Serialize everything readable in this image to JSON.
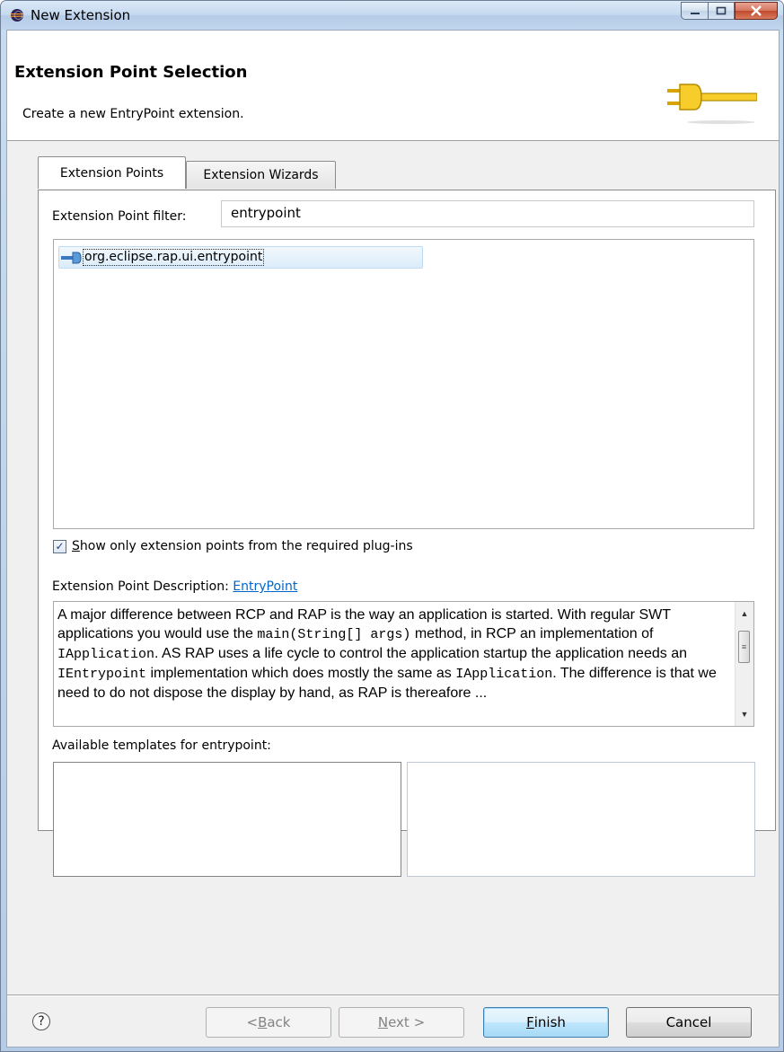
{
  "window": {
    "title": "New Extension"
  },
  "header": {
    "title": "Extension Point Selection",
    "description": "Create a new EntryPoint extension."
  },
  "tabs": [
    {
      "label": "Extension Points",
      "active": true
    },
    {
      "label": "Extension Wizards",
      "active": false
    }
  ],
  "filter": {
    "label": "Extension Point filter:",
    "value": "entrypoint"
  },
  "extension_points": [
    {
      "label": "org.eclipse.rap.ui.entrypoint",
      "selected": true
    }
  ],
  "show_required_only": {
    "label_mnemonic": "S",
    "label_rest": "how only extension points from the required plug-ins",
    "checked": true
  },
  "description": {
    "label": "Extension Point Description:",
    "link": "EntryPoint",
    "text_parts": [
      {
        "t": "A major difference between RCP and RAP is the way an application is started. With regular SWT applications you would use the ",
        "code": false
      },
      {
        "t": "main(String[] args)",
        "code": true
      },
      {
        "t": " method, in RCP an implementation of ",
        "code": false
      },
      {
        "t": "IApplication",
        "code": true
      },
      {
        "t": ". AS RAP uses a life cycle to control the application startup the application needs an ",
        "code": false
      },
      {
        "t": "IEntrypoint",
        "code": true
      },
      {
        "t": " implementation which does mostly the same as ",
        "code": false
      },
      {
        "t": "IApplication",
        "code": true
      },
      {
        "t": ". The difference is that we need to do not dispose the display by hand, as RAP is thereafore ",
        "code": false
      },
      {
        "t": "...",
        "code": false
      }
    ]
  },
  "templates": {
    "label": "Available templates for entrypoint:"
  },
  "buttons": {
    "help": "?",
    "back_mnemonic": "B",
    "back_prefix": "< ",
    "back_rest": "ack",
    "next_mnemonic": "N",
    "next_rest": "ext >",
    "finish_mnemonic": "F",
    "finish_rest": "inish",
    "cancel": "Cancel"
  },
  "colors": {
    "selection_bg": "#dcecfa",
    "link": "#0066cc",
    "default_button": "#bee6fd"
  }
}
